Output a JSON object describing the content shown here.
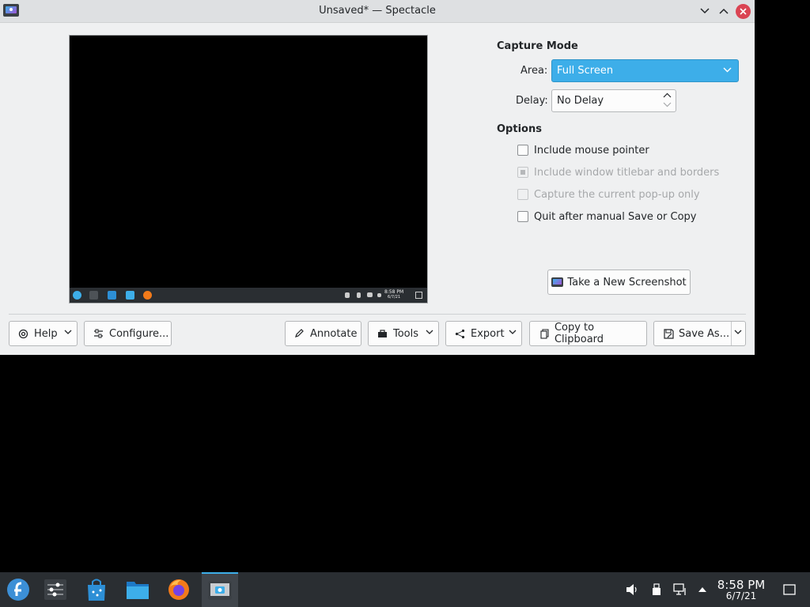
{
  "window": {
    "title": "Unsaved* — Spectacle",
    "icons": {
      "app": "spectacle-icon",
      "minimize": "chevron-down-icon",
      "maximize": "chevron-up-icon",
      "close": "close-icon"
    }
  },
  "preview": {
    "mini_clock_time": "8:58 PM",
    "mini_clock_date": "6/7/21"
  },
  "capture_mode": {
    "heading": "Capture Mode",
    "area_label": "Area:",
    "area_value": "Full Screen",
    "delay_label": "Delay:",
    "delay_value": "No Delay"
  },
  "options": {
    "heading": "Options",
    "items": [
      {
        "label": "Include mouse pointer",
        "checked": false,
        "enabled": true
      },
      {
        "label": "Include window titlebar and borders",
        "checked": "partial",
        "enabled": false
      },
      {
        "label": "Capture the current pop-up only",
        "checked": false,
        "enabled": false
      },
      {
        "label": "Quit after manual Save or Copy",
        "checked": false,
        "enabled": true
      }
    ]
  },
  "new_screenshot_label": "Take a New Screenshot",
  "buttons": {
    "help": "Help",
    "configure": "Configure...",
    "annotate": "Annotate",
    "tools": "Tools",
    "export": "Export",
    "copy": "Copy to Clipboard",
    "save_as": "Save As..."
  },
  "taskbar": {
    "items": [
      "fedora-launcher-icon",
      "system-settings-icon",
      "discover-store-icon",
      "dolphin-files-icon",
      "firefox-icon",
      "spectacle-icon"
    ],
    "tray": [
      "volume-icon",
      "usb-device-icon",
      "network-icon",
      "expand-tray-icon"
    ],
    "clock_time": "8:58 PM",
    "clock_date": "6/7/21",
    "show_desktop": "show-desktop-icon"
  },
  "colors": {
    "accent": "#3daee9",
    "close": "#da4453",
    "panel": "#2a2e32",
    "window_bg": "#eff0f1"
  }
}
